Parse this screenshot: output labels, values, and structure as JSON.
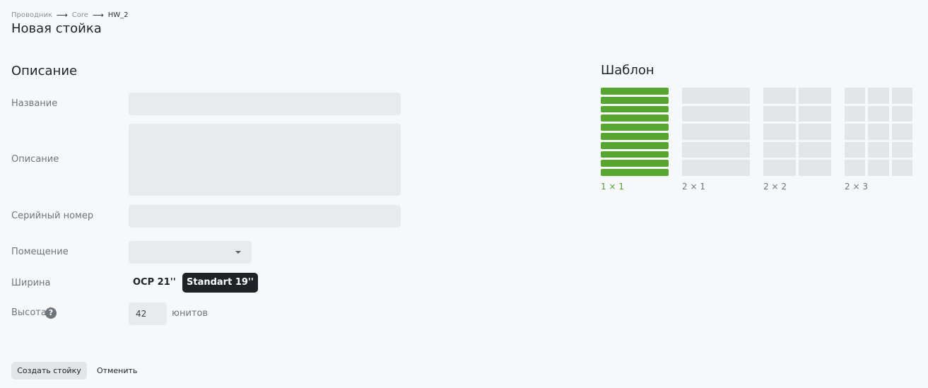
{
  "breadcrumb": [
    "Проводник",
    "Core",
    "HW_2"
  ],
  "page_title": "Новая стойка",
  "description_section": {
    "title": "Описание",
    "fields": {
      "name_label": "Название",
      "description_label": "Описание",
      "serial_label": "Серийный номер",
      "room_label": "Помещение",
      "width_label": "Ширина",
      "height_label": "Высота"
    },
    "width_options": [
      "OCP 21''",
      "Standart 19''"
    ],
    "width_selected": "Standart 19''",
    "height_value": "42",
    "height_units": "юнитов",
    "help_glyph": "?"
  },
  "template_section": {
    "title": "Шаблон",
    "templates": [
      {
        "label": "1 × 1",
        "selected": true
      },
      {
        "label": "2 × 1",
        "selected": false
      },
      {
        "label": "2 × 2",
        "selected": false
      },
      {
        "label": "2 × 3",
        "selected": false
      }
    ]
  },
  "actions": {
    "create_label": "Создать стойку",
    "cancel_label": "Отменить"
  },
  "colors": {
    "accent_green": "#58a632",
    "active_segment": "#1f2226"
  }
}
